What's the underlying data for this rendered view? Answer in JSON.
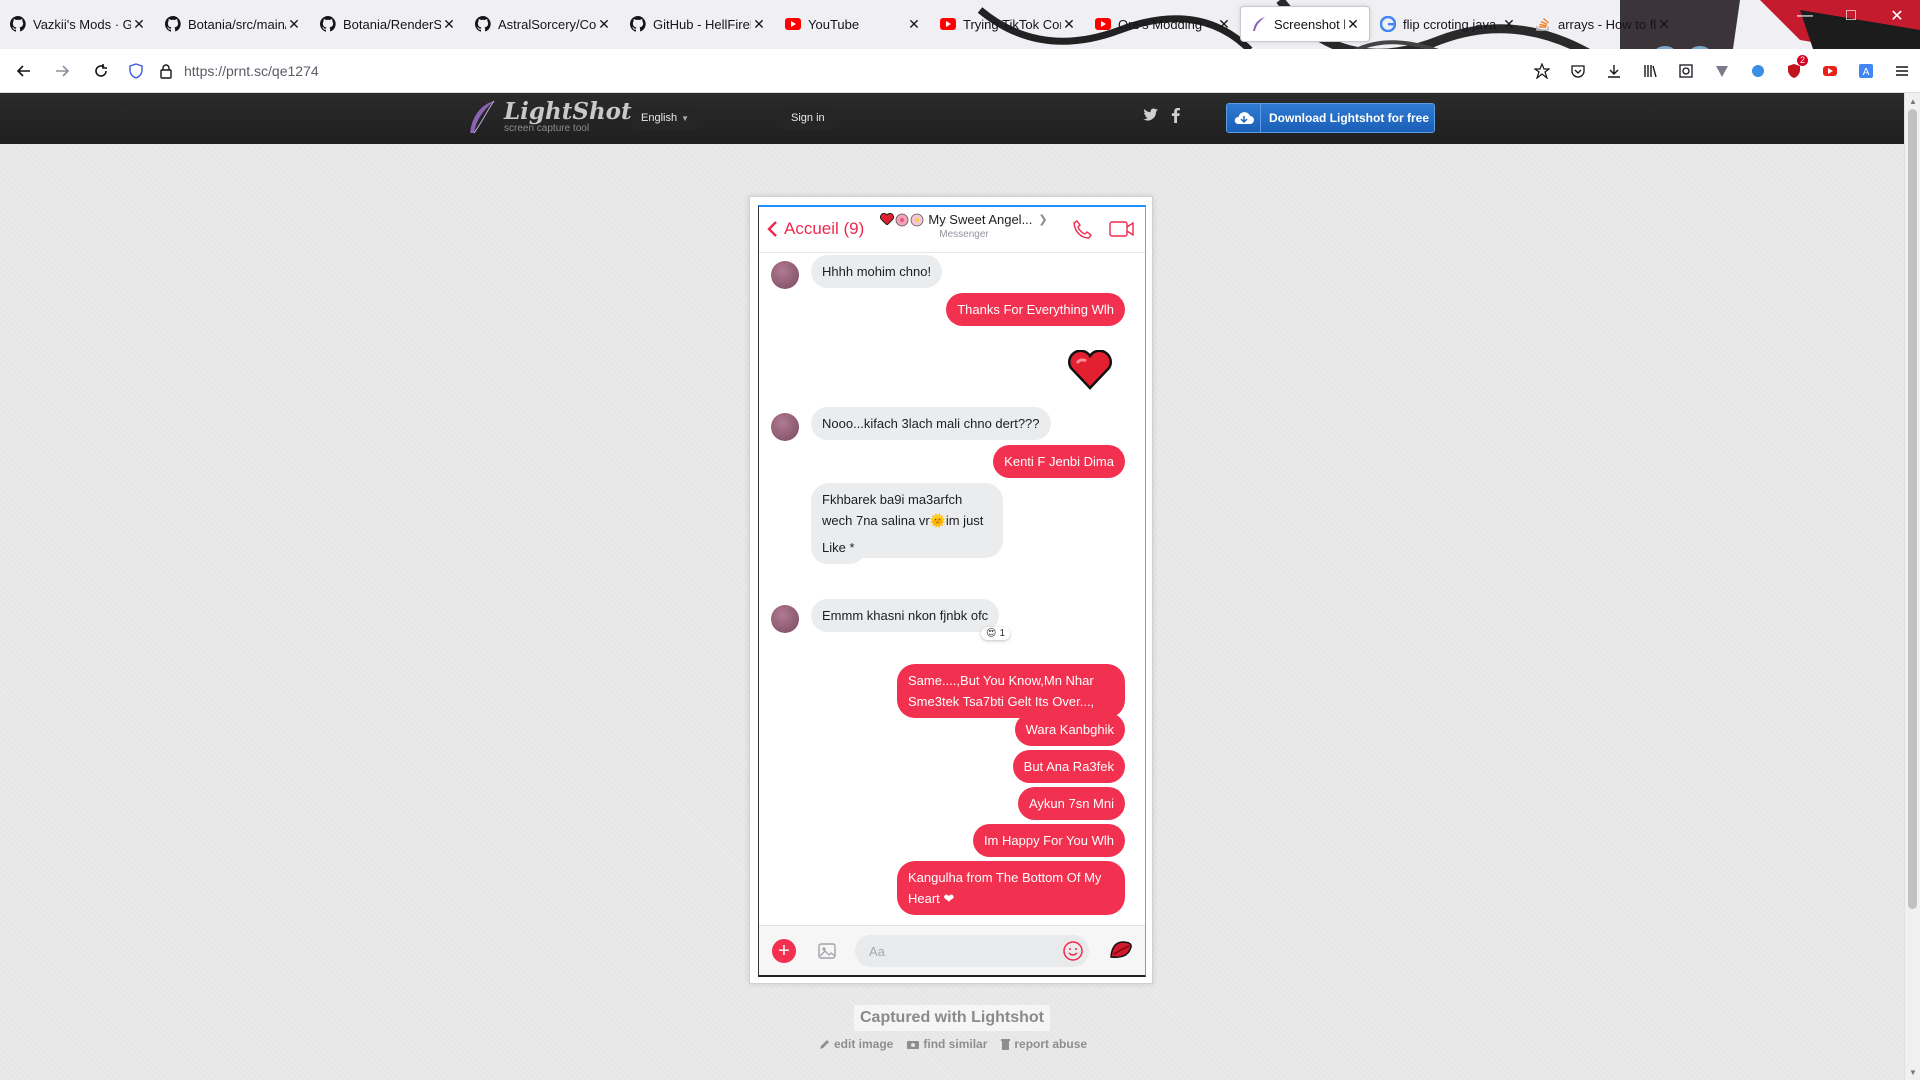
{
  "browser": {
    "tabs": [
      {
        "title": "Vazkii's Mods · GitH",
        "favicon": "github-icon"
      },
      {
        "title": "Botania/src/main/",
        "favicon": "github-icon"
      },
      {
        "title": "Botania/RenderSp",
        "favicon": "github-icon"
      },
      {
        "title": "AstralSorcery/Com",
        "favicon": "github-icon"
      },
      {
        "title": "GitHub - HellFireP",
        "favicon": "github-icon"
      },
      {
        "title": "YouTube",
        "favicon": "youtube-icon"
      },
      {
        "title": "Trying TikTok Cor",
        "favicon": "youtube-icon"
      },
      {
        "title": "Ore's Modding -",
        "favicon": "youtube-icon"
      },
      {
        "title": "Screenshot by Ligh",
        "favicon": "feather-icon",
        "active": true
      },
      {
        "title": "flip ccroting java",
        "favicon": "google-icon"
      },
      {
        "title": "arrays - How to flip",
        "favicon": "stackoverflow-icon"
      }
    ],
    "url": "https://prnt.sc/qe1274",
    "extension_badge": "2"
  },
  "lightshot": {
    "logo_name": "LightShot",
    "logo_tagline": "screen capture tool",
    "language": "English",
    "signin": "Sign in",
    "download": "Download Lightshot for free",
    "captured": "Captured with Lightshot",
    "links": [
      "edit image",
      "find similar",
      "report abuse"
    ]
  },
  "messenger": {
    "back_label": "Accueil (9)",
    "title": "My Sweet Angel...",
    "subtitle": "Messenger",
    "composer_placeholder": "Aa",
    "messages": [
      {
        "dir": "in",
        "text": "Hhhh mohim chno!"
      },
      {
        "dir": "out",
        "text": "Thanks For Everything Wlh"
      },
      {
        "dir": "out",
        "text": "❤"
      },
      {
        "dir": "in",
        "text": "Nooo...kifach 3lach mali chno dert???"
      },
      {
        "dir": "out",
        "text": "Kenti F Jenbi Dima"
      },
      {
        "dir": "in",
        "text": "Fkhbarek ba9i ma3arfch wech 7na salina vr🌞im just lik....😶"
      },
      {
        "dir": "in",
        "text": "Like *"
      },
      {
        "dir": "in",
        "text": "Emmm khasni nkon fjnbk ofc",
        "reaction": "😍",
        "reaction_count": "1"
      },
      {
        "dir": "out",
        "text": "Same....,But You Know,Mn Nhar Sme3tek Tsa7bti Gelt Its Over...,"
      },
      {
        "dir": "out",
        "text": "Wara Kanbghik"
      },
      {
        "dir": "out",
        "text": "But Ana Ra3fek"
      },
      {
        "dir": "out",
        "text": "Aykun 7sn Mni"
      },
      {
        "dir": "out",
        "text": "Im Happy For You Wlh"
      },
      {
        "dir": "out",
        "text": "Kangulha from The Bottom Of My Heart ❤"
      }
    ]
  },
  "colors": {
    "messenger_accent": "#f2304f",
    "lightshot_header": "#252525",
    "download_button": "#1f66bf"
  }
}
